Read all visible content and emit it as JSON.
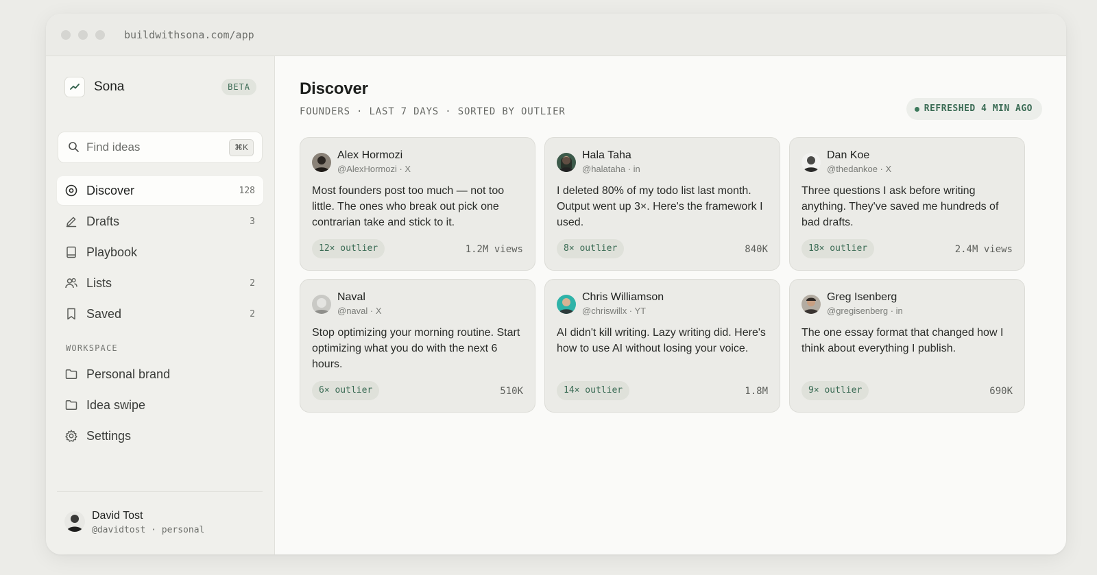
{
  "browser": {
    "url": "buildwithsona.com/app"
  },
  "brand": {
    "name": "Sona",
    "badge": "BETA"
  },
  "search": {
    "placeholder": "Find ideas",
    "shortcut": "⌘K"
  },
  "nav": [
    {
      "label": "Discover",
      "count": "128",
      "icon": "discover-icon",
      "active": true
    },
    {
      "label": "Drafts",
      "count": "3",
      "icon": "pencil-icon"
    },
    {
      "label": "Playbook",
      "count": "",
      "icon": "book-icon"
    },
    {
      "label": "Lists",
      "count": "2",
      "icon": "users-icon"
    },
    {
      "label": "Saved",
      "count": "2",
      "icon": "bookmark-icon"
    }
  ],
  "workspace": {
    "label": "WORKSPACE",
    "items": [
      {
        "label": "Personal brand",
        "icon": "folder-icon"
      },
      {
        "label": "Idea swipe",
        "icon": "folder-icon"
      },
      {
        "label": "Settings",
        "icon": "gear-icon"
      }
    ]
  },
  "user": {
    "name": "David Tost",
    "handle": "@davidtost · personal"
  },
  "main": {
    "title": "Discover",
    "subtitle": "FOUNDERS · LAST 7 DAYS · SORTED BY OUTLIER",
    "refreshed": "REFRESHED 4 MIN AGO"
  },
  "cards": [
    {
      "name": "Alex Hormozi",
      "handle": "@AlexHormozi · X",
      "text": "Most founders post too much — not too little. The ones who break out pick one contrarian take and stick to it.",
      "badge": "12× outlier",
      "views": "1.2M views"
    },
    {
      "name": "Hala Taha",
      "handle": "@halataha · in",
      "text": "I deleted 80% of my todo list last month. Output went up 3×. Here's the framework I used.",
      "badge": "8× outlier",
      "views": "840K"
    },
    {
      "name": "Dan Koe",
      "handle": "@thedankoe · X",
      "text": "Three questions I ask before writing anything. They've saved me hundreds of bad drafts.",
      "badge": "18× outlier",
      "views": "2.4M views"
    },
    {
      "name": "Naval",
      "handle": "@naval · X",
      "text": "Stop optimizing your morning routine. Start optimizing what you do with the next 6 hours.",
      "badge": "6× outlier",
      "views": "510K"
    },
    {
      "name": "Chris Williamson",
      "handle": "@chriswillx · YT",
      "text": "AI didn't kill writing. Lazy writing did. Here's how to use AI without losing your voice.",
      "badge": "14× outlier",
      "views": "1.8M"
    },
    {
      "name": "Greg Isenberg",
      "handle": "@gregisenberg · in",
      "text": "The one essay format that changed how I think about everything I publish.",
      "badge": "9× outlier",
      "views": "690K"
    }
  ],
  "colors": {
    "accent": "#3a6b54",
    "background": "#ecece8",
    "card": "#ebebe7"
  }
}
